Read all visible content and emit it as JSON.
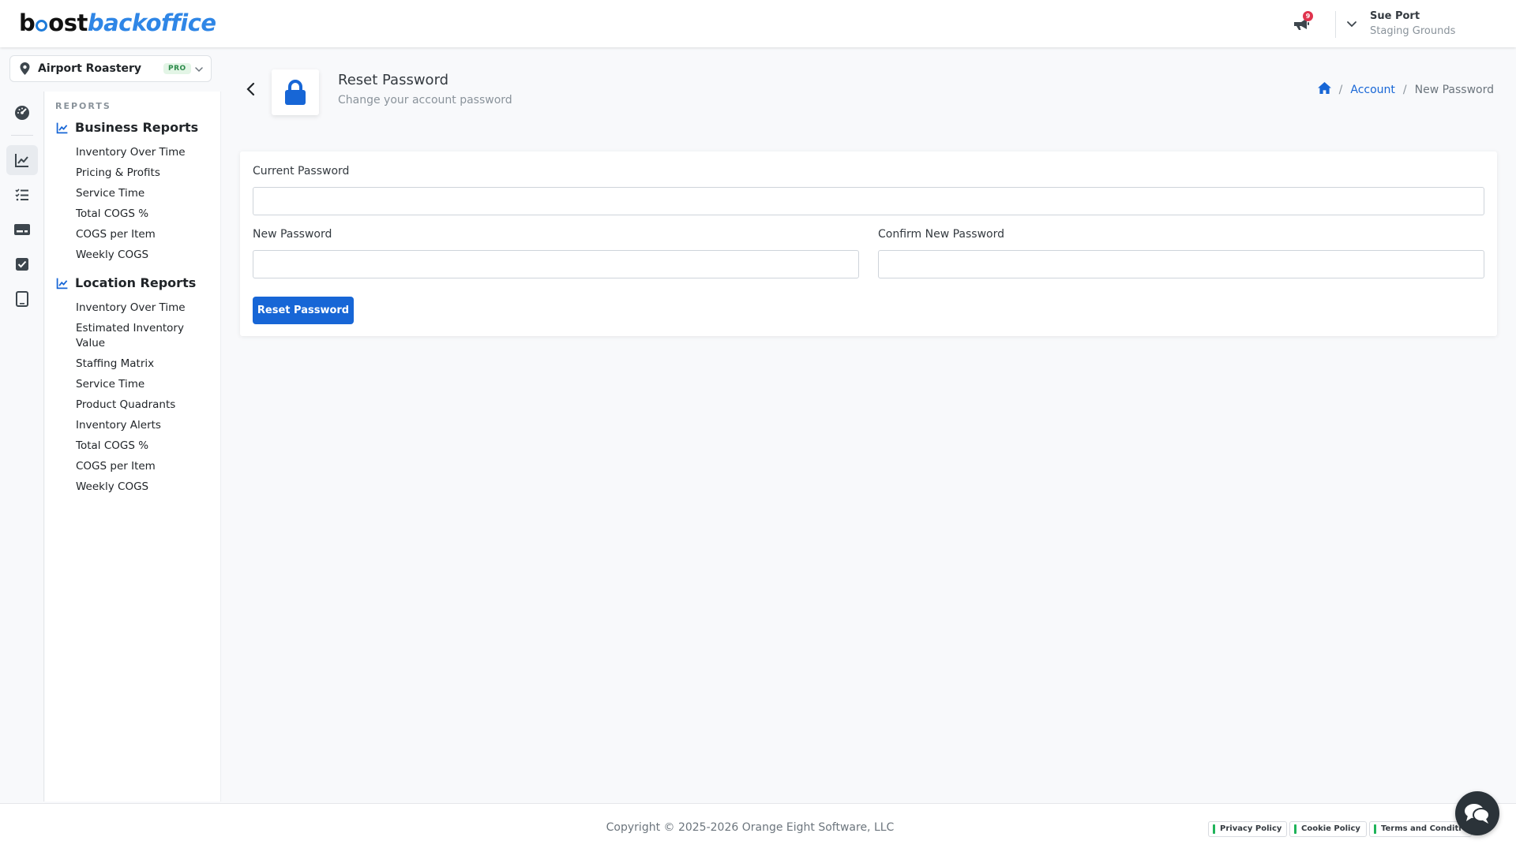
{
  "brand": {
    "part1": "b",
    "part2": "ost",
    "part3": "backoffice"
  },
  "header": {
    "notification_count": "9",
    "user_name": "Sue Port",
    "user_org": "Staging Grounds"
  },
  "location": {
    "name": "Airport Roastery",
    "tier": "PRO"
  },
  "menu": {
    "heading": "REPORTS",
    "groups": [
      {
        "title": "Business Reports",
        "items": [
          "Inventory Over Time",
          "Pricing & Profits",
          "Service Time",
          "Total COGS %",
          "COGS per Item",
          "Weekly COGS"
        ]
      },
      {
        "title": "Location Reports",
        "items": [
          "Inventory Over Time",
          "Estimated Inventory Value",
          "Staffing Matrix",
          "Service Time",
          "Product Quadrants",
          "Inventory Alerts",
          "Total COGS %",
          "COGS per Item",
          "Weekly COGS"
        ]
      }
    ]
  },
  "page": {
    "title": "Reset Password",
    "subtitle": "Change your account password",
    "breadcrumb": {
      "link": "Account",
      "current": "New Password"
    }
  },
  "form": {
    "current_label": "Current Password",
    "current_value": "",
    "new_label": "New Password",
    "new_value": "",
    "confirm_label": "Confirm New Password",
    "confirm_value": "",
    "submit_label": "Reset Password"
  },
  "footer": {
    "copyright": "Copyright © 2025-2026 Orange Eight Software, LLC",
    "links": [
      "Privacy Policy",
      "Cookie Policy",
      "Terms and Conditi"
    ]
  },
  "colors": {
    "primary": "#1766d6",
    "brand_blue": "#2f86e6",
    "badge": "#e0334d",
    "pro_green": "#2d8a4b"
  }
}
